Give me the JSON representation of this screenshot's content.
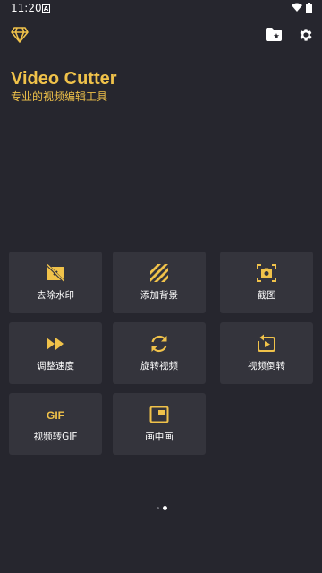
{
  "status_bar": {
    "time": "11:20",
    "notification_letter": "A"
  },
  "header": {
    "title": "Video Cutter",
    "subtitle": "专业的视频编辑工具"
  },
  "tools": [
    {
      "label": "去除水印",
      "icon": "watermark-remove-icon"
    },
    {
      "label": "添加背景",
      "icon": "background-stripes-icon"
    },
    {
      "label": "截图",
      "icon": "screenshot-camera-icon"
    },
    {
      "label": "调整速度",
      "icon": "fast-forward-icon"
    },
    {
      "label": "旋转视频",
      "icon": "rotate-arrows-icon"
    },
    {
      "label": "视频倒转",
      "icon": "reverse-video-icon"
    },
    {
      "label": "视频转GIF",
      "icon": "gif-icon",
      "icon_text": "GIF"
    },
    {
      "label": "画中画",
      "icon": "picture-in-picture-icon"
    }
  ],
  "pagination": {
    "pages": 2,
    "active_page": 2
  },
  "colors": {
    "background": "#26262e",
    "card": "#34343c",
    "accent": "#f0c24a",
    "text": "#ffffff"
  }
}
